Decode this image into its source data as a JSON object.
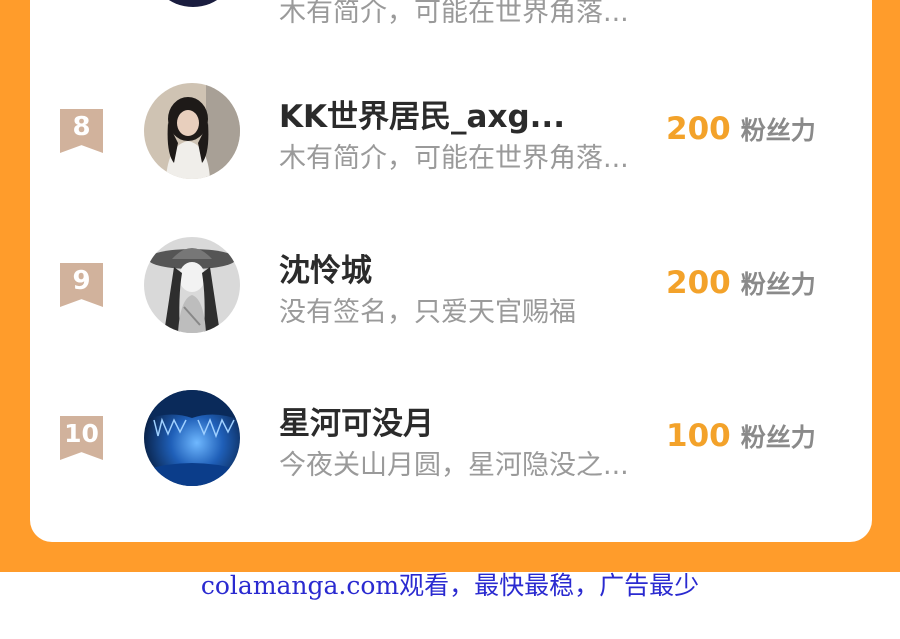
{
  "rows": [
    {
      "rank": "",
      "name": "",
      "bio": "木有简介，可能在世界角落...",
      "fans_value": "",
      "fans_label": ""
    },
    {
      "rank": "8",
      "name": "KK世界居民_axg...",
      "bio": "木有简介，可能在世界角落...",
      "fans_value": "200",
      "fans_label": "粉丝力"
    },
    {
      "rank": "9",
      "name": "沈怜城",
      "bio": "没有签名，只爱天官赐福",
      "fans_value": "200",
      "fans_label": "粉丝力"
    },
    {
      "rank": "10",
      "name": "星河可没月",
      "bio": "今夜关山月圆，星河隐没之...",
      "fans_value": "100",
      "fans_label": "粉丝力"
    }
  ],
  "footer": {
    "text": "colamanga.com观看，最快最稳，广告最少"
  },
  "colors": {
    "frame": "#ff9c2b",
    "rank_badge": "#d1b29c",
    "fans_value": "#f3a22a",
    "link": "#2a2ad0"
  }
}
